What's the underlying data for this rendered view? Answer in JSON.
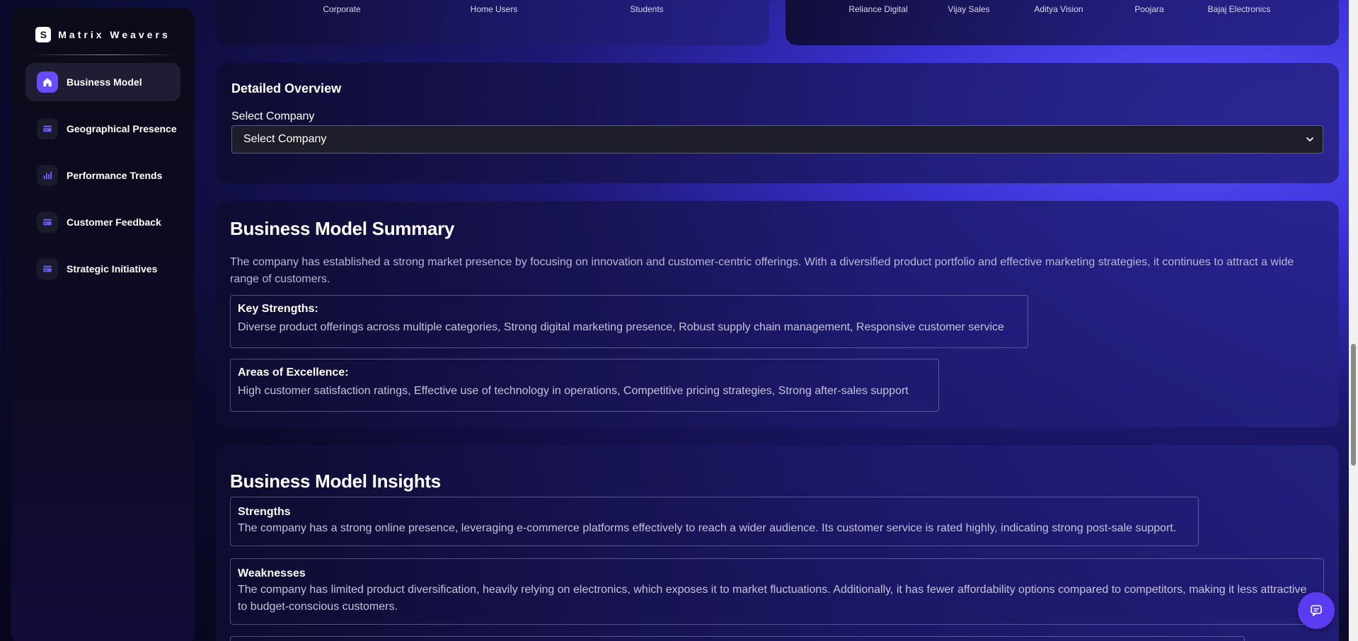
{
  "brand": {
    "logo_letter": "S",
    "name": "Matrix Weavers"
  },
  "sidebar": {
    "items": [
      {
        "label": "Business Model",
        "icon": "home-icon",
        "active": true
      },
      {
        "label": "Geographical Presence",
        "icon": "card-icon"
      },
      {
        "label": "Performance Trends",
        "icon": "bar-chart-icon"
      },
      {
        "label": "Customer Feedback",
        "icon": "card-icon"
      },
      {
        "label": "Strategic Initiatives",
        "icon": "card-icon"
      }
    ]
  },
  "charts": {
    "left": {
      "categories": [
        "Corporate",
        "Home Users",
        "Students"
      ]
    },
    "right": {
      "categories": [
        "Reliance Digital",
        "Vijay Sales",
        "Aditya Vision",
        "Poojara",
        "Bajaj Electronics"
      ]
    }
  },
  "overview": {
    "title": "Detailed Overview",
    "select_label": "Select Company",
    "select_value": "Select Company"
  },
  "summary": {
    "title": "Business Model Summary",
    "description": "The company has established a strong market presence by focusing on innovation and customer-centric offerings. With a diversified product portfolio and effective marketing strategies, it continues to attract a wide range of customers.",
    "key_strengths_title": "Key Strengths:",
    "key_strengths_text": "Diverse product offerings across multiple categories, Strong digital marketing presence, Robust supply chain management, Responsive customer service",
    "excellence_title": "Areas of Excellence:",
    "excellence_text": "High customer satisfaction ratings, Effective use of technology in operations, Competitive pricing strategies, Strong after-sales support"
  },
  "insights": {
    "title": "Business Model Insights",
    "strengths_title": "Strengths",
    "strengths_text": "The company has a strong online presence, leveraging e-commerce platforms effectively to reach a wider audience. Its customer service is rated highly, indicating strong post-sale support.",
    "weaknesses_title": "Weaknesses",
    "weaknesses_text": "The company has limited product diversification, heavily relying on electronics, which exposes it to market fluctuations. Additionally, it has fewer affordability options compared to competitors, making it less attractive to budget-conscious customers."
  },
  "colors": {
    "accent": "#6a4cff",
    "chat_button": "#5b3bf0"
  }
}
